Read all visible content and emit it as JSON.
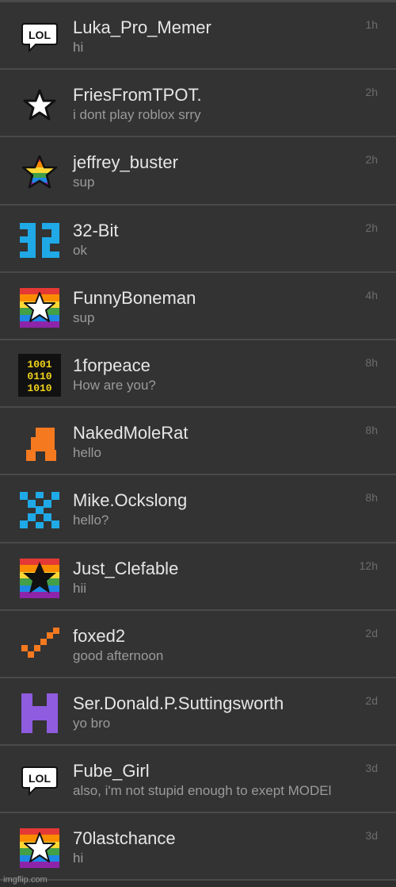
{
  "colors": {
    "background": "#2e2e2e",
    "row": "#333333",
    "divider": "#4a4a4a",
    "name": "#e6e6e6",
    "preview": "#9a9a9a",
    "time": "#6d6d6d"
  },
  "chats": [
    {
      "name": "Luka_Pro_Memer",
      "preview": "hi",
      "time": "1h",
      "avatar": "lol-speech-bubble-icon"
    },
    {
      "name": "FriesFromTPOT.",
      "preview": "i dont play roblox srry",
      "time": "2h",
      "avatar": "outline-star-icon"
    },
    {
      "name": "jeffrey_buster",
      "preview": "sup",
      "time": "2h",
      "avatar": "rainbow-star-icon"
    },
    {
      "name": "32-Bit",
      "preview": "ok",
      "time": "2h",
      "avatar": "pixel-32-icon"
    },
    {
      "name": "FunnyBoneman",
      "preview": "sup",
      "time": "4h",
      "avatar": "rainbow-square-white-star-icon"
    },
    {
      "name": "1forpeace",
      "preview": "How are you?",
      "time": "8h",
      "avatar": "binary-code-icon"
    },
    {
      "name": "NakedMoleRat",
      "preview": "hello",
      "time": "8h",
      "avatar": "orange-pixel-creature-icon"
    },
    {
      "name": "Mike.Ockslong",
      "preview": "hello?",
      "time": "8h",
      "avatar": "blue-pixel-x-icon"
    },
    {
      "name": "Just_Clefable",
      "preview": "hii",
      "time": "12h",
      "avatar": "rainbow-square-black-star-icon"
    },
    {
      "name": "foxed2",
      "preview": "good afternoon",
      "time": "2d",
      "avatar": "orange-checkmark-icon"
    },
    {
      "name": "Ser.Donald.P.Suttingsworth",
      "preview": "yo bro",
      "time": "2d",
      "avatar": "purple-pixel-h-icon"
    },
    {
      "name": "Fube_Girl",
      "preview": "also, i'm not stupid enough to exept MODEl",
      "time": "3d",
      "avatar": "lol-speech-bubble-icon"
    },
    {
      "name": "70lastchance",
      "preview": "hi",
      "time": "3d",
      "avatar": "rainbow-square-white-star-icon"
    }
  ],
  "watermark": "imgflip.com"
}
